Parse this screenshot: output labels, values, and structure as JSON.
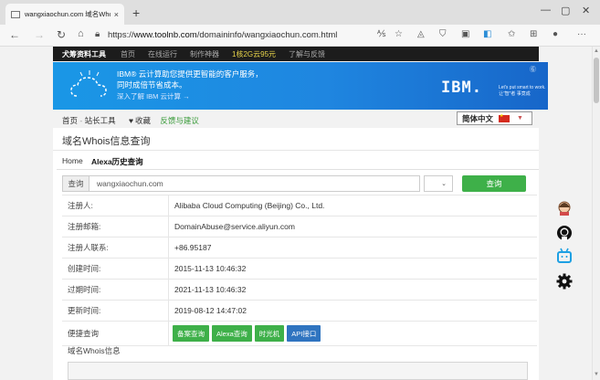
{
  "browser": {
    "tab_title": "wangxiaochun.com 域名Whois信息",
    "tab_close": "×",
    "new_tab": "+",
    "min": "—",
    "max": "▢",
    "close": "✕",
    "url_prefix": "https://",
    "url_host": "www.toolnb.com",
    "url_path": "/domaininfo/wangxiaochun.com.html"
  },
  "topnav": {
    "logo": "犬筹资料工具",
    "items": [
      "首页",
      "在线运行",
      "制作神器"
    ],
    "promo": "1核2G云95元",
    "last": "了解与反馈"
  },
  "banner": {
    "line1": "IBM® 云计算助您提供更智能的客户服务，",
    "line2": "同时成倍节省成本。",
    "line3": "深入了解 IBM 云计算 →",
    "logo": "IBM.",
    "tag1": "Let's put smart to work.",
    "tag2": "让“智”者 事竟成",
    "corner": "Ⓖ"
  },
  "breadcrumb": {
    "home": "首页",
    "sep": " - ",
    "tools": "站长工具",
    "favorite": "收藏",
    "feedback": "反馈与建议"
  },
  "language": "简体中文",
  "card": {
    "title": "域名Whois信息查询",
    "tab_home": "Home",
    "tab_alexa": "Alexa历史查询"
  },
  "search": {
    "label": "查询",
    "value": "wangxiaochun.com",
    "button": "查询"
  },
  "info_rows": [
    {
      "label": "注册人:",
      "value": "Alibaba Cloud Computing (Beijing) Co., Ltd."
    },
    {
      "label": "注册邮箱:",
      "value": "DomainAbuse@service.aliyun.com"
    },
    {
      "label": "注册人联系:",
      "value": "+86.95187"
    },
    {
      "label": "创建时间:",
      "value": "2015-11-13 10:46:32"
    },
    {
      "label": "过期时间:",
      "value": "2021-11-13 10:46:32"
    },
    {
      "label": "更新时间:",
      "value": "2019-08-12 14:47:02"
    }
  ],
  "quick": {
    "label": "便捷查询",
    "buttons": [
      "备案查询",
      "Alexa查询",
      "时光机",
      "API接口"
    ]
  },
  "whois_section": "域名Whois信息"
}
